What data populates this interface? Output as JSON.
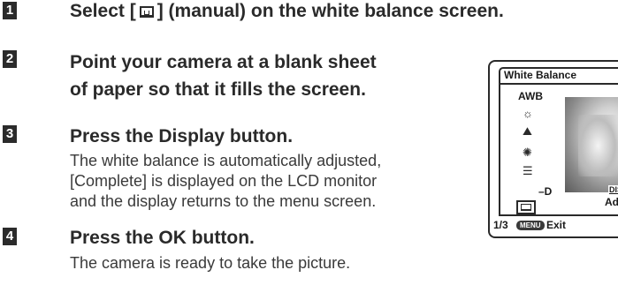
{
  "steps": [
    {
      "number": "1",
      "title_before": "Select [",
      "title_icon": "manual-white-balance-icon",
      "title_after": "] (manual) on the white balance screen.",
      "lines": []
    },
    {
      "number": "2",
      "title_lines": [
        "Point your camera at a blank sheet",
        "of paper so that it fills the screen."
      ],
      "lines": []
    },
    {
      "number": "3",
      "title": "Press the Display button.",
      "lines": [
        "The white balance is automatically adjusted,",
        "[Complete] is displayed on the LCD monitor",
        "and the display returns to the menu screen."
      ]
    },
    {
      "number": "4",
      "title": "Press the OK button.",
      "lines": [
        "The camera is ready to take the picture."
      ]
    }
  ],
  "lcd": {
    "title": "White Balance",
    "options": [
      "AWB",
      "daylight-icon",
      "shade-icon",
      "tungsten-icon",
      "fluorescent-icon",
      "manual-icon"
    ],
    "fluorescent_suffix": "–D",
    "disp_label": "DISP",
    "adjust_label": "Adj",
    "page": "1/3",
    "menu_label": "MENU",
    "exit_label": "Exit"
  }
}
